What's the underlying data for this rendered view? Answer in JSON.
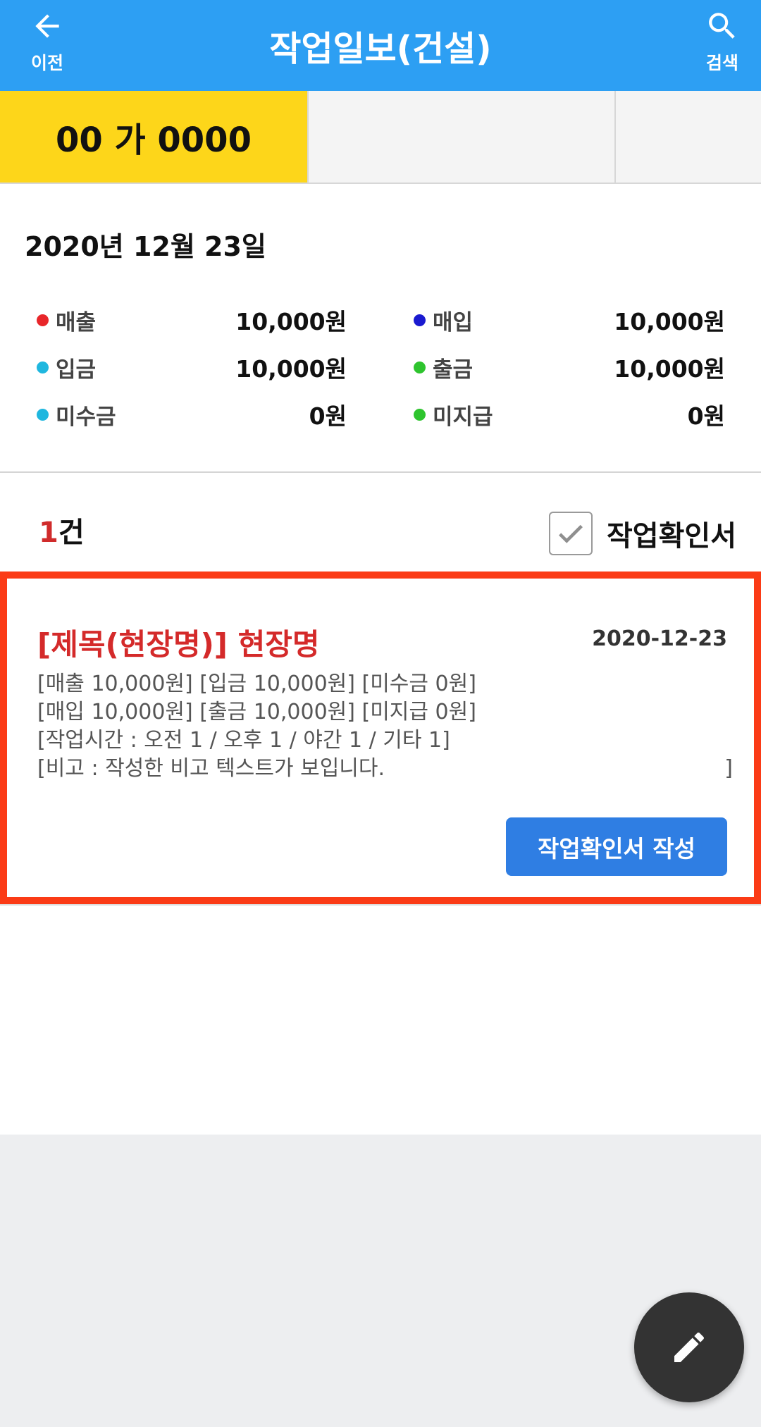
{
  "appbar": {
    "title": "작업일보(건설)",
    "back_label": "이전",
    "search_label": "검색",
    "back_icon": "arrow-left-icon",
    "search_icon": "search-icon"
  },
  "tabs": [
    {
      "label": "00 가 0000",
      "active": true
    },
    {
      "label": ""
    },
    {
      "label": ""
    }
  ],
  "summary": {
    "date": "2020년 12월 23일",
    "items": [
      {
        "label": "매출",
        "value": "10,000원",
        "color": "#e8262a"
      },
      {
        "label": "매입",
        "value": "10,000원",
        "color": "#1a1ad0"
      },
      {
        "label": "입금",
        "value": "10,000원",
        "color": "#1fb7df"
      },
      {
        "label": "출금",
        "value": "10,000원",
        "color": "#2ec42e"
      },
      {
        "label": "미수금",
        "value": "0원",
        "color": "#1fb7df"
      },
      {
        "label": "미지급",
        "value": "0원",
        "color": "#2ec42e"
      }
    ]
  },
  "list": {
    "count_num": "1",
    "count_unit": "건",
    "checkbox_label": "작업확인서",
    "checkbox_checked": true
  },
  "card": {
    "title": "[제목(현장명)] 현장명",
    "date": "2020-12-23",
    "line1": "[매출 10,000원] [입금 10,000원] [미수금 0원]",
    "line2": "[매입 10,000원] [출금 10,000원] [미지급 0원]",
    "line3": "[작업시간 : 오전 1 / 오후 1 / 야간 1 / 기타 1]",
    "memo_text": "[비고 : 작성한 비고 텍스트가 보입니다.",
    "memo_close": "]",
    "button_label": "작업확인서 작성"
  },
  "fab": {
    "icon": "pencil-icon"
  },
  "colors": {
    "appbar": "#2d9ff3",
    "active_tab": "#fdd61a",
    "card_border": "#fb3b16",
    "button": "#2f7ee3",
    "title_red": "#d42a2a"
  }
}
